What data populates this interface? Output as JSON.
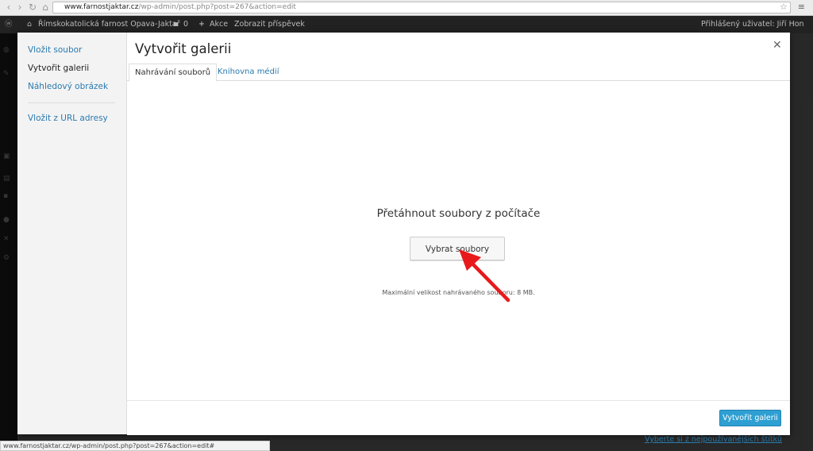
{
  "browser": {
    "url_host": "www.farnostjaktar.cz",
    "url_path": "/wp-admin/post.php?post=267&action=edit"
  },
  "adminbar": {
    "site_name": "Římskokatolická farnost Opava-Jaktař",
    "comments_count": "0",
    "new_label": "Akce",
    "view_post": "Zobrazit příspěvek",
    "user": "Přihlášený uživatel: Jiří Hon"
  },
  "modal": {
    "sidebar": [
      "Vložit soubor",
      "Vytvořit galerii",
      "Náhledový obrázek",
      "Vložit z URL adresy"
    ],
    "title": "Vytvořit galerii",
    "tabs": [
      "Nahrávání souborů",
      "Knihovna médií"
    ],
    "drop_text": "Přetáhnout soubory z počítače",
    "select_button": "Vybrat soubory",
    "max_size": "Maximální velikost nahrávaného souboru: 8 MB.",
    "primary_button": "Vytvořit galerii"
  },
  "background_link": "Vyberte si z nejpoužívanějších štítků",
  "status_bar": "www.farnostjaktar.cz/wp-admin/post.php?post=267&action=edit#",
  "colors": {
    "accent": "#2e9fd2",
    "link": "#2a7ab0",
    "arrow": "#e8191b"
  }
}
